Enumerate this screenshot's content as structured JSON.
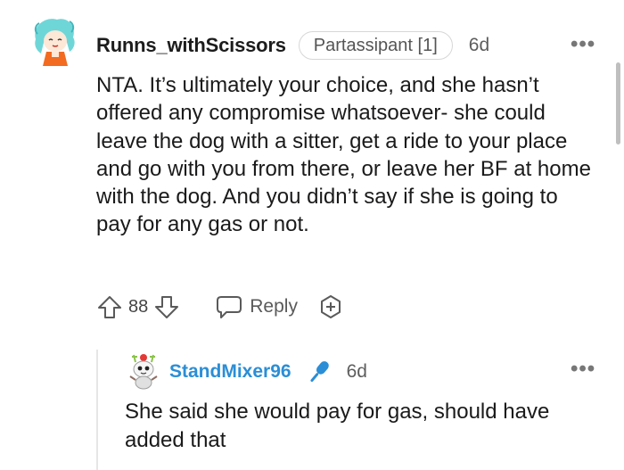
{
  "top_comment": {
    "username": "Runns_withScissors",
    "flair": "Partassipant [1]",
    "age": "6d",
    "more": "•••",
    "body": "NTA. It’s ultimately your choice, and she hasn’t offered any compromise whatsoever- she could leave the dog with a sitter, get a ride to your place and go with you from there, or leave her BF at home with the dog. And you didn’t say if she is going to pay for any gas or not.",
    "votes": "88",
    "reply_label": "Reply"
  },
  "reply_comment": {
    "username": "StandMixer96",
    "age": "6d",
    "more": "•••",
    "body": "She said she would pay for gas, should have added that"
  },
  "colors": {
    "username_reply": "#2b8ed6",
    "mic_icon": "#2b8ed6",
    "text": "#1a1a1b",
    "muted": "#5d5d5d"
  },
  "icons": {
    "upvote": "upvote-arrow-icon",
    "downvote": "downvote-arrow-icon",
    "reply": "speech-bubble-icon",
    "award": "award-plus-icon",
    "mic": "microphone-icon"
  }
}
